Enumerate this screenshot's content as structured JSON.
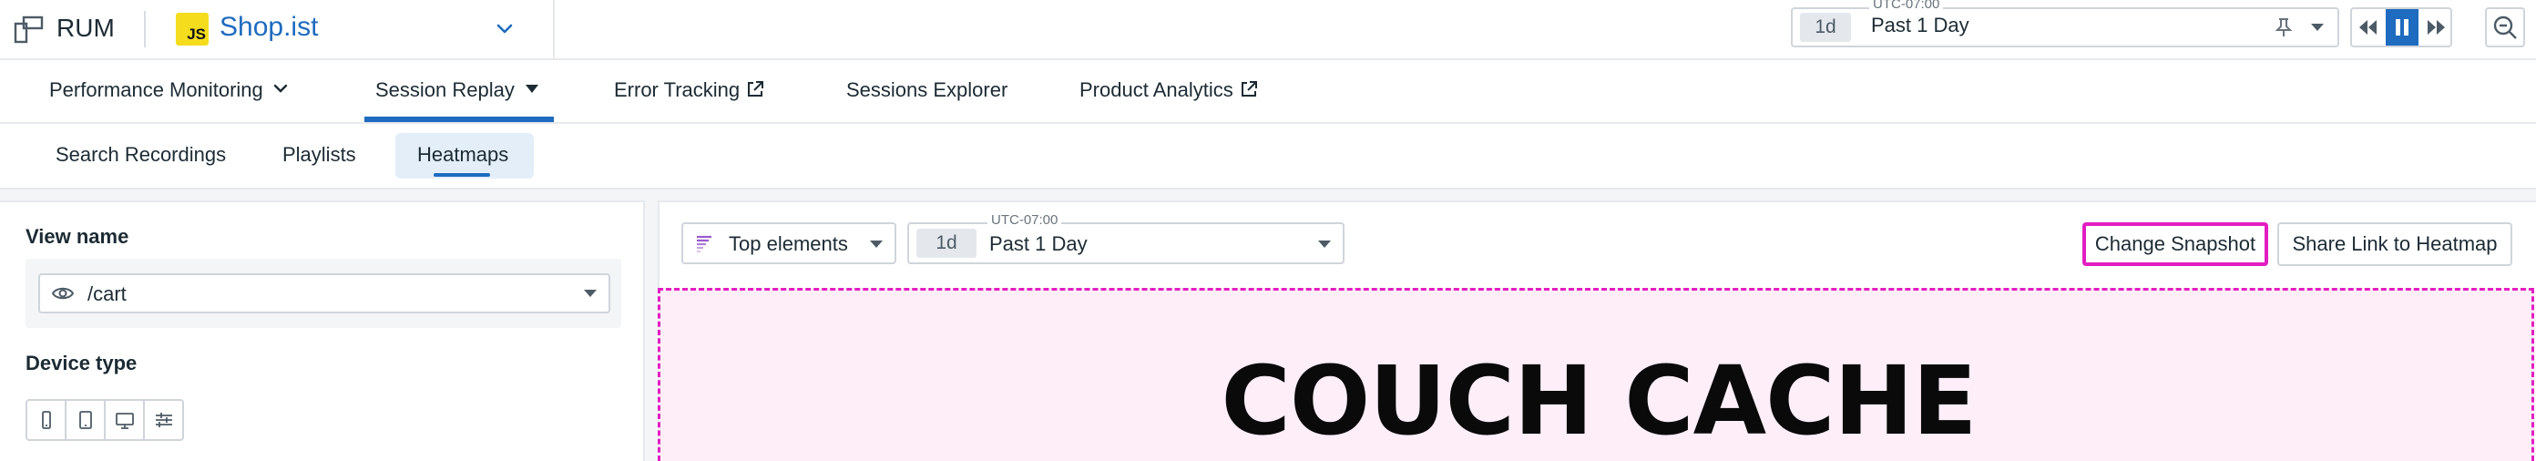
{
  "topbar": {
    "product_name": "RUM",
    "app_badge": "JS",
    "app_name": "Shop.ist",
    "time_picker": {
      "timezone": "UTC-07:00",
      "duration": "1d",
      "label": "Past 1 Day"
    }
  },
  "nav": {
    "items": [
      {
        "label": "Performance Monitoring",
        "icon": "chevron-down-icon"
      },
      {
        "label": "Session Replay",
        "icon": "caret-down-icon",
        "active": true
      },
      {
        "label": "Error Tracking",
        "icon": "external-link-icon"
      },
      {
        "label": "Sessions Explorer"
      },
      {
        "label": "Product Analytics",
        "icon": "external-link-icon"
      }
    ]
  },
  "subnav": {
    "items": [
      {
        "label": "Search Recordings"
      },
      {
        "label": "Playlists"
      },
      {
        "label": "Heatmaps",
        "active": true
      }
    ]
  },
  "sidebar": {
    "view_name_label": "View name",
    "view_name_value": "/cart",
    "device_type_label": "Device type",
    "device_options": [
      "mobile-icon",
      "tablet-icon",
      "desktop-icon",
      "sliders-icon"
    ]
  },
  "toolbar": {
    "element_select": "Top elements",
    "time_picker": {
      "timezone": "UTC-07:00",
      "duration": "1d",
      "label": "Past 1 Day"
    },
    "change_snapshot_label": "Change Snapshot",
    "share_link_label": "Share Link to Heatmap"
  },
  "preview": {
    "title": "COUCH CACHE"
  },
  "colors": {
    "accent": "#1e6bbf",
    "highlight": "#e21ec2",
    "preview_bg": "#fdeef8",
    "js_badge": "#f5dd1e"
  }
}
